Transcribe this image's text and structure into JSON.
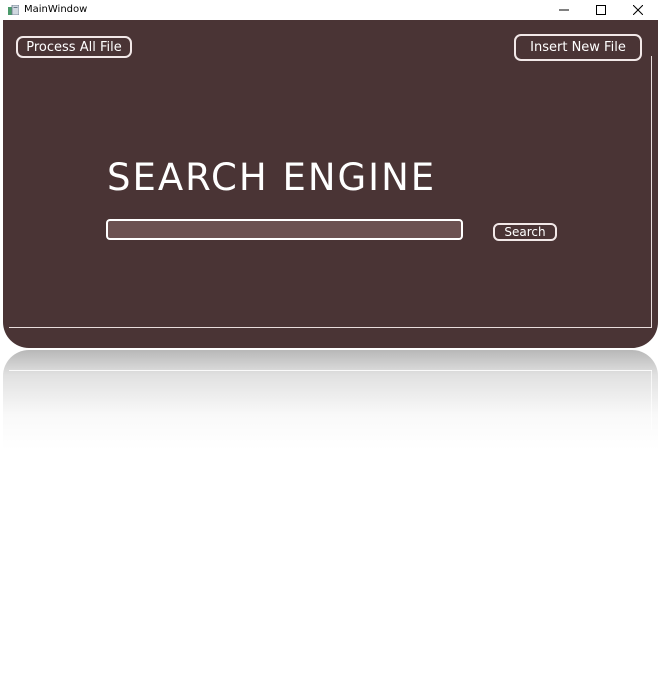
{
  "window": {
    "title": "MainWindow",
    "controls": [
      "minimize-icon",
      "maximize-icon",
      "close-icon"
    ]
  },
  "toolbar": {
    "process_label": "Process All File",
    "insert_label": "Insert New File"
  },
  "main": {
    "heading": "SEARCH ENGINE",
    "search_value": "",
    "search_button_label": "Search"
  },
  "colors": {
    "panel_background": "#4a3435",
    "input_background": "#6c5151",
    "border": "#f2e8e8",
    "text": "#ffffff"
  }
}
